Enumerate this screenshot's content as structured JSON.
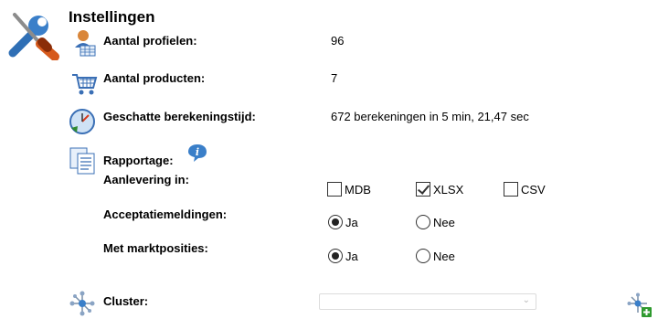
{
  "title": "Instellingen",
  "rows": {
    "profiles": {
      "label": "Aantal profielen:",
      "value": "96"
    },
    "products": {
      "label": "Aantal producten:",
      "value": "7"
    },
    "calc_time": {
      "label": "Geschatte berekeningstijd:",
      "value": "672 berekeningen in 5 min, 21,47 sec"
    },
    "report": {
      "label": "Rapportage:"
    },
    "delivery": {
      "label": "Aanlevering in:",
      "options": [
        {
          "label": "MDB",
          "checked": false
        },
        {
          "label": "XLSX",
          "checked": true
        },
        {
          "label": "CSV",
          "checked": false
        }
      ]
    },
    "acceptance": {
      "label": "Acceptatiemeldingen:",
      "options": [
        {
          "label": "Ja",
          "checked": true
        },
        {
          "label": "Nee",
          "checked": false
        }
      ]
    },
    "market": {
      "label": "Met marktposities:",
      "options": [
        {
          "label": "Ja",
          "checked": true
        },
        {
          "label": "Nee",
          "checked": false
        }
      ]
    },
    "cluster": {
      "label": "Cluster:",
      "value": ""
    }
  },
  "icons": {
    "tools": "tools-icon",
    "profiles": "profile-icon",
    "products": "shopping-cart-icon",
    "calc_time": "clock-icon",
    "report": "report-icon",
    "info": "info-icon",
    "cluster": "network-icon",
    "add_cluster": "add-network-icon"
  }
}
